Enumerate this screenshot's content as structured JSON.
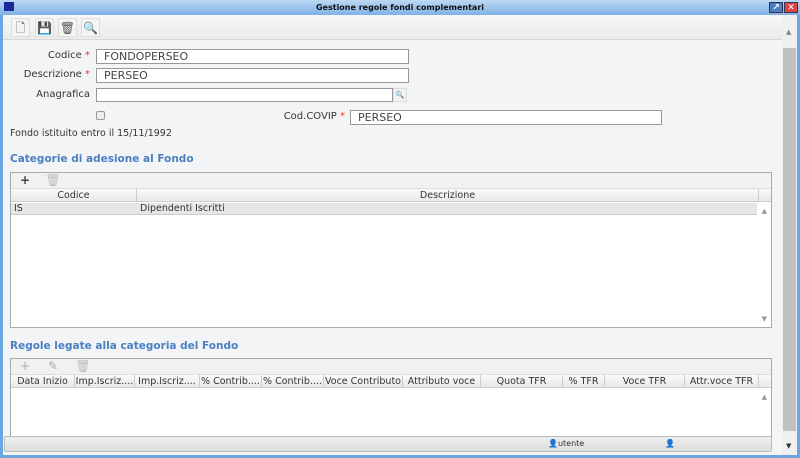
{
  "window": {
    "title": "Gestione regole fondi complementari"
  },
  "toolbar": {
    "icons": [
      "new-document-icon",
      "save-icon",
      "trash-icon",
      "search-icon"
    ]
  },
  "form": {
    "codice_label": "Codice",
    "codice_value": "FONDOPERSEO",
    "descrizione_label": "Descrizione",
    "descrizione_value": "PERSEO",
    "anagrafica_label": "Anagrafica",
    "anagrafica_value": "",
    "covip_label": "Cod.COVIP",
    "covip_value": "PERSEO",
    "required_mark": "*",
    "checkbox_label": "Fondo istituito entro il 15/11/1992",
    "checkbox_checked": false
  },
  "categorie": {
    "title": "Categorie di adesione al Fondo",
    "columns": [
      "Codice",
      "Descrizione"
    ],
    "rows": [
      {
        "codice": "IS",
        "descrizione": "Dipendenti Iscritti"
      }
    ]
  },
  "regole": {
    "title": "Regole legate alla categoria del Fondo",
    "columns": [
      "Data Inizio",
      "Imp.Iscriz....",
      "Imp.Iscriz....",
      "% Contrib....",
      "% Contrib....",
      "Voce Contributo",
      "Attributo voce",
      "Quota TFR",
      "% TFR",
      "Voce TFR",
      "Attr.voce TFR"
    ],
    "rows": []
  },
  "statusbar": {
    "user_label": "utente"
  },
  "colors": {
    "accent": "#4a7fc1",
    "required": "#e33333",
    "titlebar": "#7fb2e6"
  }
}
